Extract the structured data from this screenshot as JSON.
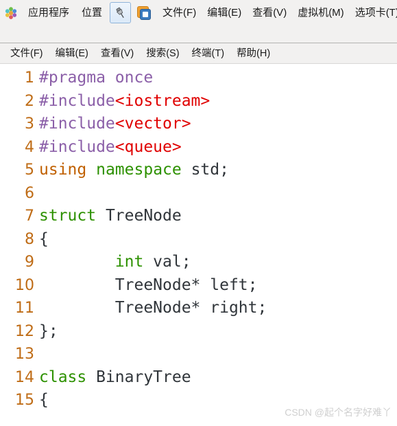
{
  "desktop_panel": {
    "logo_icon": "gnome-foot-icon",
    "items": [
      {
        "label": "应用程序",
        "name": "panel-item-applications"
      },
      {
        "label": "位置",
        "name": "panel-item-places"
      }
    ]
  },
  "vmware_window": {
    "pin_icon": "pin-icon",
    "app_icon": "vmware-logo-icon",
    "menu": [
      {
        "label": "文件(F)"
      },
      {
        "label": "编辑(E)"
      },
      {
        "label": "查看(V)"
      },
      {
        "label": "虚拟机(M)"
      },
      {
        "label": "选项卡(T)"
      }
    ]
  },
  "terminal": {
    "menu": [
      {
        "label": "文件(F)"
      },
      {
        "label": "编辑(E)"
      },
      {
        "label": "查看(V)"
      },
      {
        "label": "搜索(S)"
      },
      {
        "label": "终端(T)"
      },
      {
        "label": "帮助(H)"
      }
    ]
  },
  "editor": {
    "lines": [
      {
        "n": "1",
        "tokens": [
          {
            "t": "#pragma once",
            "c": "tok-pre"
          }
        ]
      },
      {
        "n": "2",
        "tokens": [
          {
            "t": "#include",
            "c": "tok-pre"
          },
          {
            "t": "<iostream>",
            "c": "tok-str"
          }
        ]
      },
      {
        "n": "3",
        "tokens": [
          {
            "t": "#include",
            "c": "tok-pre"
          },
          {
            "t": "<vector>",
            "c": "tok-str"
          }
        ]
      },
      {
        "n": "4",
        "tokens": [
          {
            "t": "#include",
            "c": "tok-pre"
          },
          {
            "t": "<queue>",
            "c": "tok-str"
          }
        ]
      },
      {
        "n": "5",
        "tokens": [
          {
            "t": "using",
            "c": "tok-kw"
          },
          {
            "t": " ",
            "c": "tok-plain"
          },
          {
            "t": "namespace",
            "c": "tok-type"
          },
          {
            "t": " std;",
            "c": "tok-plain"
          }
        ]
      },
      {
        "n": "6",
        "tokens": [
          {
            "t": "",
            "c": "tok-plain"
          }
        ]
      },
      {
        "n": "7",
        "tokens": [
          {
            "t": "struct",
            "c": "tok-type"
          },
          {
            "t": " TreeNode",
            "c": "tok-plain"
          }
        ]
      },
      {
        "n": "8",
        "tokens": [
          {
            "t": "{",
            "c": "tok-plain"
          }
        ]
      },
      {
        "n": "9",
        "tokens": [
          {
            "t": "        ",
            "c": "tok-plain"
          },
          {
            "t": "int",
            "c": "tok-type"
          },
          {
            "t": " val;",
            "c": "tok-plain"
          }
        ]
      },
      {
        "n": "10",
        "tokens": [
          {
            "t": "        TreeNode* left;",
            "c": "tok-plain"
          }
        ]
      },
      {
        "n": "11",
        "tokens": [
          {
            "t": "        TreeNode* right;",
            "c": "tok-plain"
          }
        ]
      },
      {
        "n": "12",
        "tokens": [
          {
            "t": "};",
            "c": "tok-plain"
          }
        ]
      },
      {
        "n": "13",
        "tokens": [
          {
            "t": "",
            "c": "tok-plain"
          }
        ]
      },
      {
        "n": "14",
        "tokens": [
          {
            "t": "class",
            "c": "tok-type"
          },
          {
            "t": " BinaryTree",
            "c": "tok-plain"
          }
        ]
      },
      {
        "n": "15",
        "tokens": [
          {
            "t": "{",
            "c": "tok-plain"
          }
        ]
      }
    ]
  },
  "watermark": {
    "text": "CSDN @起个名字好难丫"
  }
}
